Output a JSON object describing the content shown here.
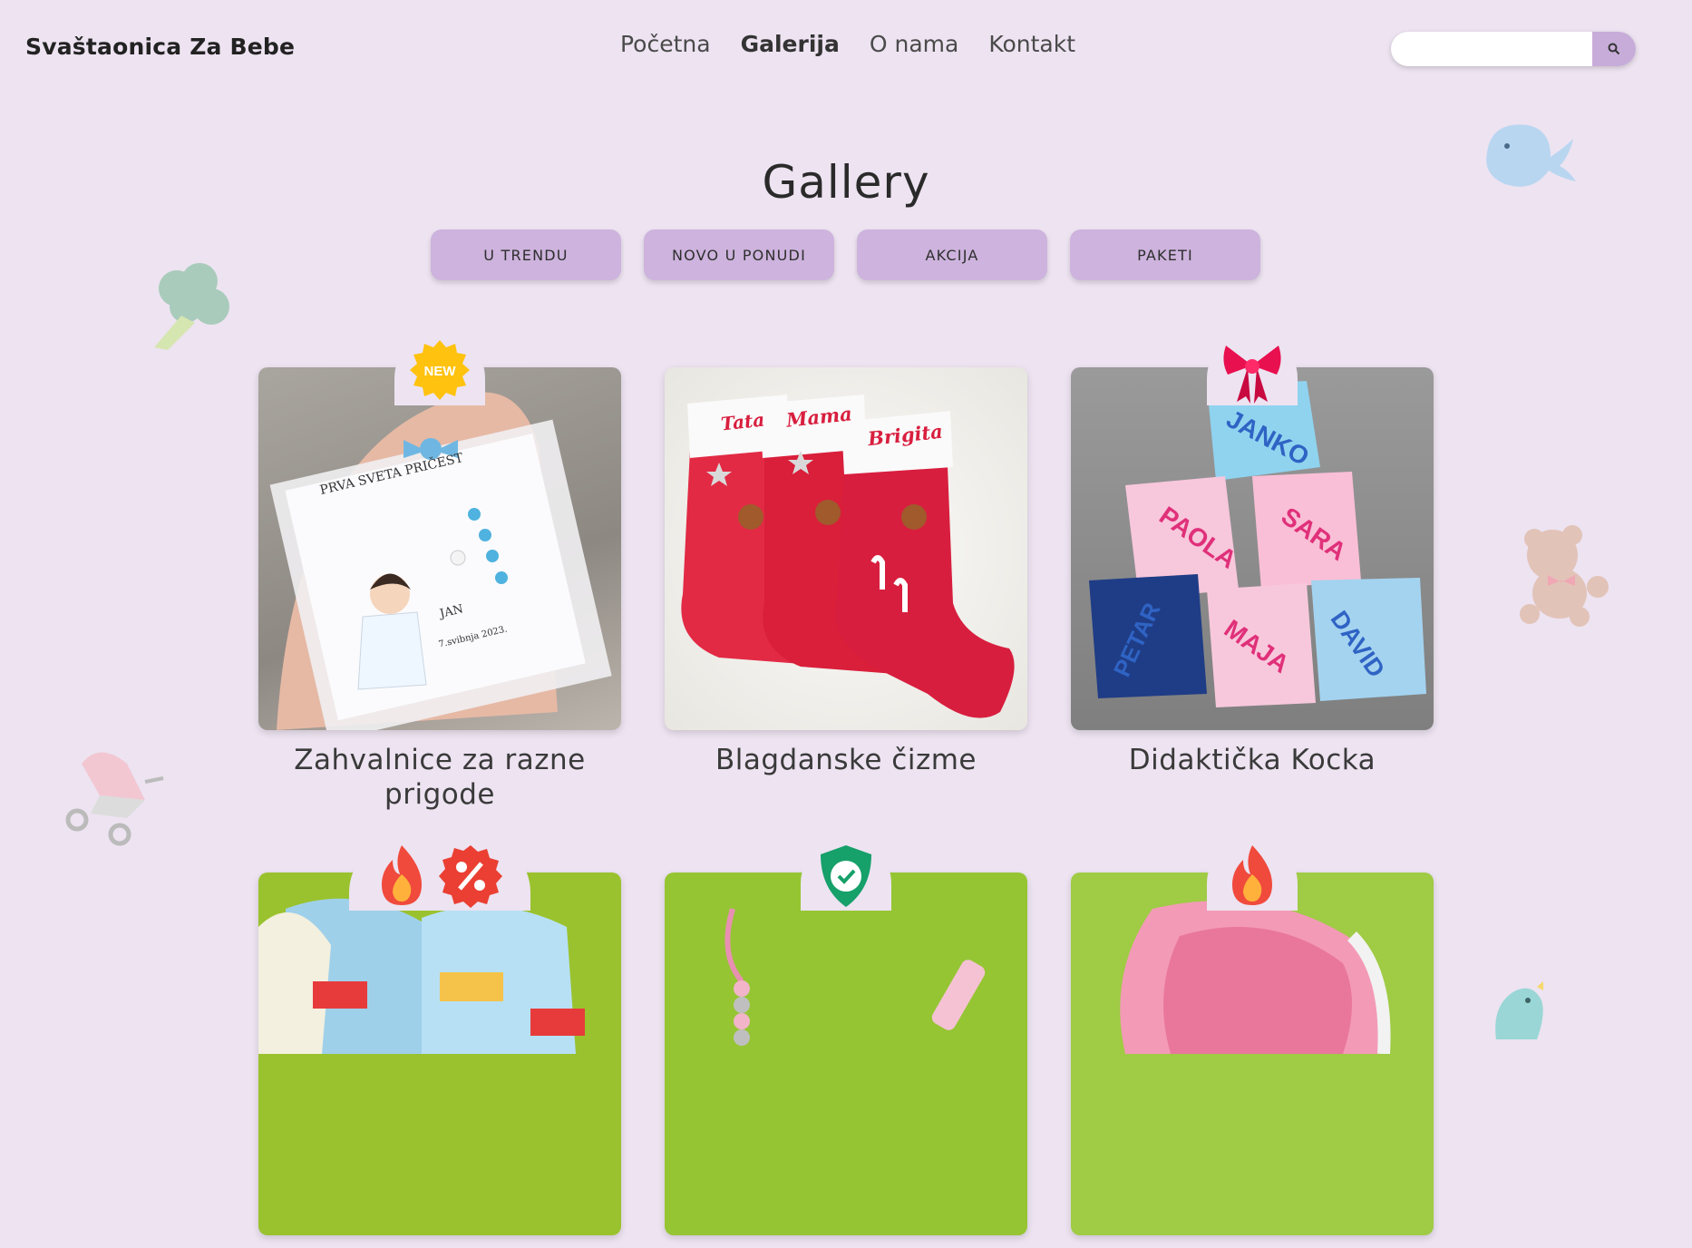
{
  "header": {
    "brand": "Svaštaonica Za Bebe",
    "nav": [
      "Početna",
      "Galerija",
      "O nama",
      "Kontakt"
    ],
    "active_nav": "Galerija",
    "search_placeholder": ""
  },
  "page_title": "Gallery",
  "filters": [
    "U TRENDU",
    "NOVO U PONUDI",
    "AKCIJA",
    "PAKETI"
  ],
  "colors": {
    "background": "#ede3f1",
    "accent": "#cdb3dd",
    "search_button": "#c7acd9"
  },
  "cards": [
    {
      "caption": "Zahvalnice za razne prigode",
      "badges": [
        "new-badge-icon"
      ]
    },
    {
      "caption": "Blagdanske čizme",
      "badges": []
    },
    {
      "caption": "Didaktička Kocka",
      "badges": [
        "gift-bow-icon"
      ]
    },
    {
      "caption": "",
      "badges": [
        "fire-icon",
        "discount-percent-icon"
      ]
    },
    {
      "caption": "",
      "badges": [
        "verified-shield-icon"
      ]
    },
    {
      "caption": "",
      "badges": [
        "fire-icon"
      ]
    }
  ],
  "card_texts": {
    "favor_card_title": "PRVA SVETA PRIČEST",
    "favor_card_name": "JAN",
    "favor_card_date": "7.svibnja 2023.",
    "favor_badge": "NEW",
    "stocking_names": [
      "Tata",
      "Mama",
      "Brigita"
    ],
    "cube_names": [
      "JANKO",
      "PAOLA",
      "SARA",
      "PETAR",
      "MAJA",
      "DAVID"
    ]
  },
  "decorations": [
    "whale-icon",
    "broccoli-icon",
    "teddy-bear-icon",
    "stroller-icon",
    "dinosaur-icon"
  ]
}
